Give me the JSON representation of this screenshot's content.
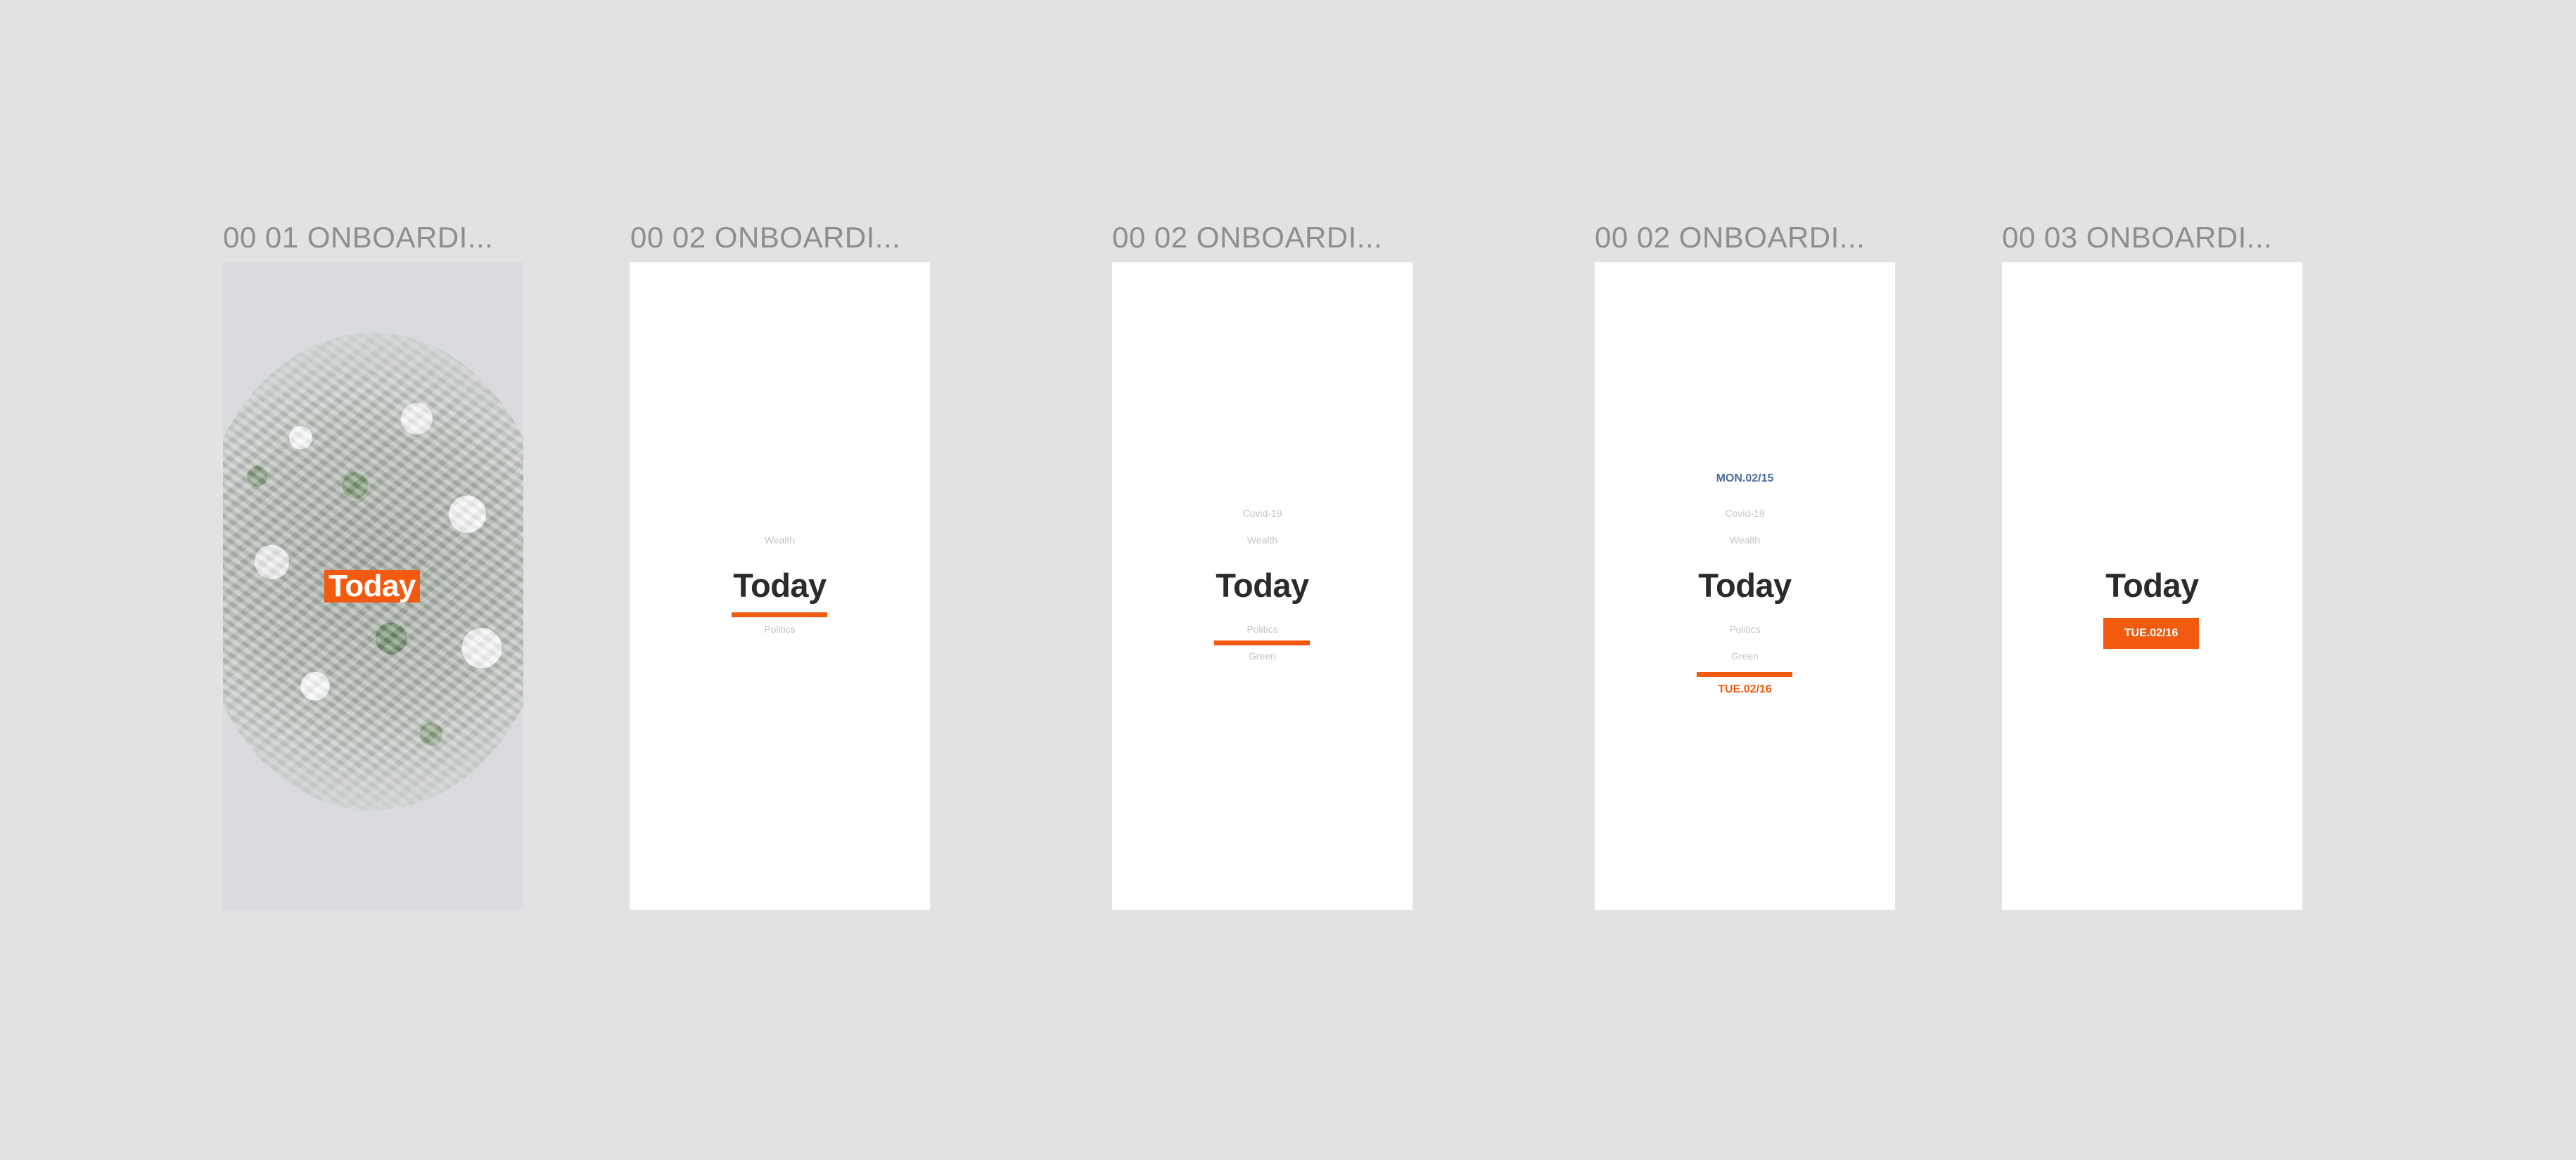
{
  "artboards": [
    {
      "title": "00 01 ONBOARDI...",
      "today": "Today"
    },
    {
      "title": "00 02 ONBOARDI...",
      "topic_above": "Wealth",
      "today": "Today",
      "topic_below": "Politics"
    },
    {
      "title": "00 02 ONBOARDI...",
      "topics_above": [
        "Covid-19",
        "Wealth"
      ],
      "today": "Today",
      "topics_below": [
        "Politics",
        "Green"
      ]
    },
    {
      "title": "00 02 ONBOARDI...",
      "date_top": "MON.02/15",
      "topics_above": [
        "Covid-19",
        "Wealth"
      ],
      "today": "Today",
      "topics_below": [
        "Politics",
        "Green"
      ],
      "date_bottom": "TUE.02/16"
    },
    {
      "title": "00 03 ONBOARDI...",
      "today": "Today",
      "date_chip": "TUE.02/16"
    }
  ],
  "colors": {
    "canvas": "#e2e2e2",
    "accent": "#f25a10",
    "date_blue": "#4d6b9a",
    "heading": "#2b2b2b",
    "muted_topic": "#c4c4c4",
    "artboard_label": "#8e8e8e"
  }
}
